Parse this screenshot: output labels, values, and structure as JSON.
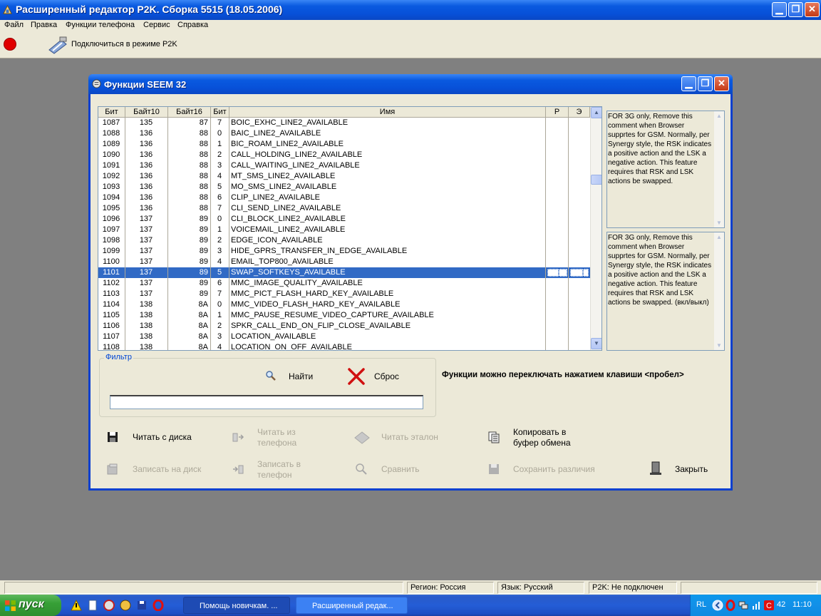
{
  "app": {
    "title": "Расширенный редактор P2K. Сборка 5515 (18.05.2006)",
    "menu": [
      "Файл",
      "Правка",
      "Функции телефона",
      "Сервис",
      "Справка"
    ],
    "toolbar": {
      "connect_label": "Подключиться в режиме P2K"
    }
  },
  "dialog": {
    "title": "Функции SEEM 32",
    "columns": [
      "Бит",
      "Байт10",
      "Байт16",
      "Бит",
      "Имя",
      "Р",
      "Э"
    ],
    "rows": [
      [
        "1087",
        "135",
        "87",
        "7",
        "BOIC_EXHC_LINE2_AVAILABLE"
      ],
      [
        "1088",
        "136",
        "88",
        "0",
        "BAIC_LINE2_AVAILABLE"
      ],
      [
        "1089",
        "136",
        "88",
        "1",
        "BIC_ROAM_LINE2_AVAILABLE"
      ],
      [
        "1090",
        "136",
        "88",
        "2",
        "CALL_HOLDING_LINE2_AVAILABLE"
      ],
      [
        "1091",
        "136",
        "88",
        "3",
        "CALL_WAITING_LINE2_AVAILABLE"
      ],
      [
        "1092",
        "136",
        "88",
        "4",
        "MT_SMS_LINE2_AVAILABLE"
      ],
      [
        "1093",
        "136",
        "88",
        "5",
        "MO_SMS_LINE2_AVAILABLE"
      ],
      [
        "1094",
        "136",
        "88",
        "6",
        "CLIP_LINE2_AVAILABLE"
      ],
      [
        "1095",
        "136",
        "88",
        "7",
        "CLI_SEND_LINE2_AVAILABLE"
      ],
      [
        "1096",
        "137",
        "89",
        "0",
        "CLI_BLOCK_LINE2_AVAILABLE"
      ],
      [
        "1097",
        "137",
        "89",
        "1",
        "VOICEMAIL_LINE2_AVAILABLE"
      ],
      [
        "1098",
        "137",
        "89",
        "2",
        "EDGE_ICON_AVAILABLE"
      ],
      [
        "1099",
        "137",
        "89",
        "3",
        "HIDE_GPRS_TRANSFER_IN_EDGE_AVAILABLE"
      ],
      [
        "1100",
        "137",
        "89",
        "4",
        "EMAIL_TOP800_AVAILABLE"
      ],
      [
        "1101",
        "137",
        "89",
        "5",
        "SWAP_SOFTKEYS_AVAILABLE"
      ],
      [
        "1102",
        "137",
        "89",
        "6",
        "MMC_IMAGE_QUALITY_AVAILABLE"
      ],
      [
        "1103",
        "137",
        "89",
        "7",
        "MMC_PICT_FLASH_HARD_KEY_AVAILABLE"
      ],
      [
        "1104",
        "138",
        "8A",
        "0",
        "MMC_VIDEO_FLASH_HARD_KEY_AVAILABLE"
      ],
      [
        "1105",
        "138",
        "8A",
        "1",
        "MMC_PAUSE_RESUME_VIDEO_CAPTURE_AVAILABLE"
      ],
      [
        "1106",
        "138",
        "8A",
        "2",
        "SPKR_CALL_END_ON_FLIP_CLOSE_AVAILABLE"
      ],
      [
        "1107",
        "138",
        "8A",
        "3",
        "LOCATION_AVAILABLE"
      ],
      [
        "1108",
        "138",
        "8A",
        "4",
        "LOCATION_ON_OFF_AVAILABLE"
      ]
    ],
    "selected_row": 14,
    "desc1": "FOR 3G only, Remove this comment when Browser supprtes for GSM. Normally, per Synergy style, the RSK indicates a positive action and the LSK a negative action. This feature requires that RSK and LSK actions be swapped.",
    "desc2": "FOR 3G only, Remove this comment when Browser supprtes for GSM. Normally, per Synergy style, the RSK indicates a positive action and the LSK a negative action. This feature requires that RSK and LSK actions be swapped. (вкл/выкл)",
    "filter": {
      "legend": "Фильтр",
      "find": "Найти",
      "reset": "Сброс",
      "value": ""
    },
    "hint": "Функции можно переключать нажатием клавиши <пробел>",
    "actions": {
      "read_disk": "Читать с диска",
      "read_phone_1": "Читать из",
      "read_phone_2": "телефона",
      "read_ref": "Читать эталон",
      "copy_1": "Копировать в",
      "copy_2": "буфер обмена",
      "write_disk": "Записать на диск",
      "write_phone_1": "Записать в",
      "write_phone_2": "телефон",
      "compare": "Сравнить",
      "save_diff": "Сохранить различия",
      "close": "Закрыть"
    }
  },
  "status": {
    "region": "Регион: Россия",
    "language": "Язык: Русский",
    "p2k": "P2K: Не подключен"
  },
  "taskbar": {
    "start": "пуск",
    "tasks": [
      "Помощь новичкам. ...",
      "Расширенный редак..."
    ],
    "lang": "RL",
    "tray_num": "42",
    "clock": "11:10"
  }
}
